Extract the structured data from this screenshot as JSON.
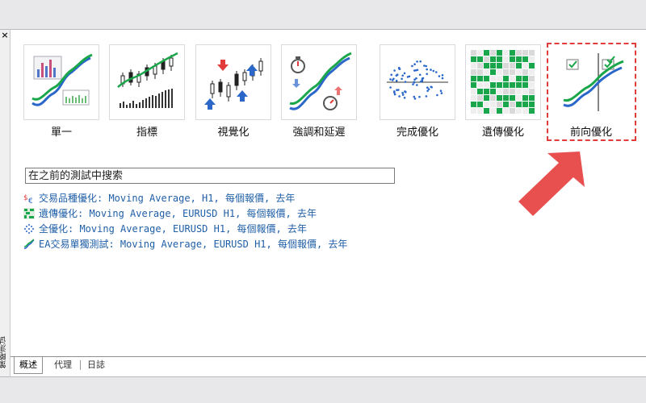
{
  "window": {
    "close_glyph": "×",
    "side_panel_title": "策略测试"
  },
  "modes": [
    {
      "id": "single",
      "label": "單一",
      "icon": "single-icon"
    },
    {
      "id": "indicator",
      "label": "指標",
      "icon": "indicator-icon"
    },
    {
      "id": "visual",
      "label": "視覺化",
      "icon": "visual-icon"
    },
    {
      "id": "stress",
      "label": "強調和延遲",
      "icon": "stress-delay-icon"
    },
    {
      "id": "complete",
      "label": "完成優化",
      "icon": "complete-optimization-icon"
    },
    {
      "id": "genetic",
      "label": "遺傳優化",
      "icon": "genetic-optimization-icon"
    },
    {
      "id": "forward",
      "label": "前向優化",
      "icon": "forward-optimization-icon",
      "highlighted": true
    }
  ],
  "search": {
    "placeholder": "在之前的測試中搜索",
    "value": ""
  },
  "history": [
    {
      "icon": "currency-icon",
      "text": "交易品種優化: Moving Average, H1, 每個報價, 去年"
    },
    {
      "icon": "genetic-icon",
      "text": "遺傳優化: Moving Average, EURUSD H1, 每個報價, 去年"
    },
    {
      "icon": "complete-icon",
      "text": "全優化: Moving Average, EURUSD H1, 每個報價, 去年"
    },
    {
      "icon": "single-test-icon",
      "text": "EA交易單獨測試: Moving Average, EURUSD H1, 每個報價, 去年"
    }
  ],
  "tabs": {
    "overview": "概述",
    "agents": "代理",
    "journal": "日誌"
  },
  "colors": {
    "highlight": "#e23b3b",
    "arrow": "#e8504f",
    "link": "#1f5fa8",
    "green": "#1aa64a",
    "blue": "#2a67c9"
  }
}
